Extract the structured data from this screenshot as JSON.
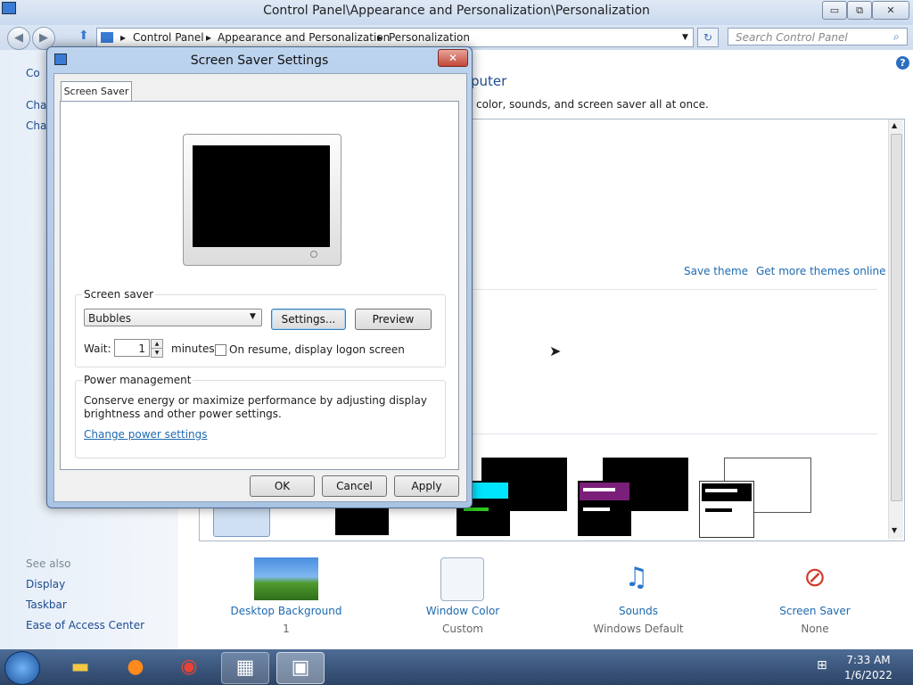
{
  "main_window": {
    "title": "Control Panel\\Appearance and Personalization\\Personalization",
    "minimize": "▭",
    "maximize": "⧉",
    "close": "✕"
  },
  "address_bar": {
    "crumbs": [
      "Control Panel",
      "Appearance and Personalization",
      "Personalization"
    ],
    "search_placeholder": "Search Control Panel"
  },
  "left_pane": {
    "top_partial": [
      "Co",
      "Cha",
      "Cha"
    ],
    "see_also_label": "See also",
    "see_also_links": [
      "Display",
      "Taskbar",
      "Ease of Access Center"
    ]
  },
  "content": {
    "heading_fragment": "puter",
    "desc_fragment": "color, sounds, and screen saver all at once.",
    "save_theme": "Save theme",
    "get_more_themes": "Get more themes online"
  },
  "bottom_items": [
    {
      "label": "Desktop Background",
      "value": "1"
    },
    {
      "label": "Window Color",
      "value": "Custom"
    },
    {
      "label": "Sounds",
      "value": "Windows Default"
    },
    {
      "label": "Screen Saver",
      "value": "None"
    }
  ],
  "taskbar": {
    "time": "7:33 AM",
    "date": "1/6/2022"
  },
  "dialog": {
    "title": "Screen Saver Settings",
    "tab": "Screen Saver",
    "screen_saver_group": "Screen saver",
    "selected_saver": "Bubbles",
    "settings_button": "Settings...",
    "preview_button": "Preview",
    "wait_label": "Wait:",
    "wait_value": "1",
    "minutes_label": "minutes",
    "resume_label": "On resume, display logon screen",
    "power_group": "Power management",
    "power_text_1": "Conserve energy or maximize performance by adjusting display",
    "power_text_2": "brightness and other power settings.",
    "power_link": "Change power settings",
    "ok": "OK",
    "cancel": "Cancel",
    "apply": "Apply"
  },
  "colors": {
    "link": "#1e6ab0",
    "theme_cyan": "#00e5ff",
    "theme_purple": "#7a1f7a",
    "theme_yellow": "#9aa20a",
    "theme_green": "#2cc81e"
  }
}
